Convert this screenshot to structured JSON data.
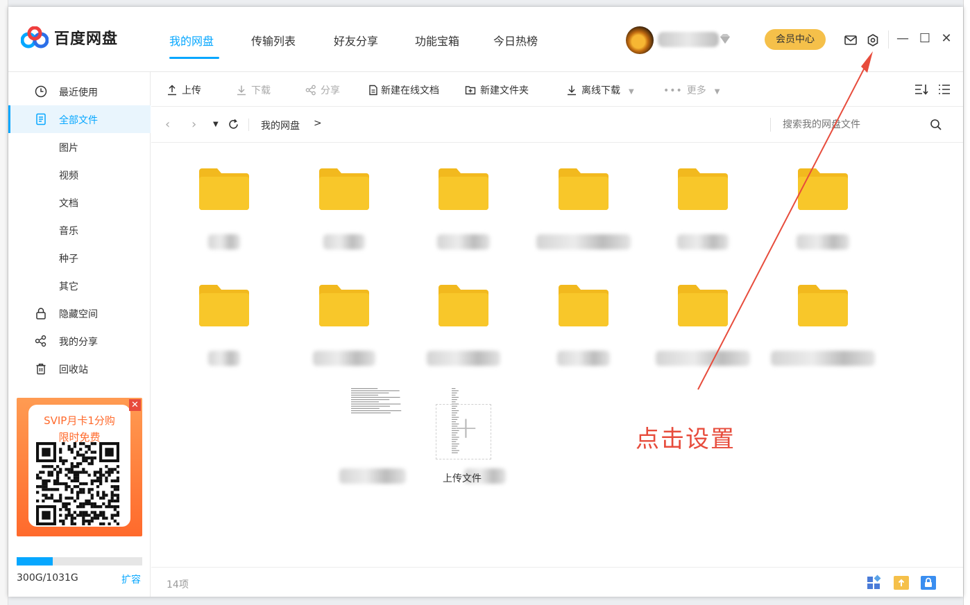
{
  "app": {
    "name": "百度网盘"
  },
  "nav": {
    "tabs": [
      {
        "label": "我的网盘",
        "active": true
      },
      {
        "label": "传输列表"
      },
      {
        "label": "好友分享"
      },
      {
        "label": "功能宝箱"
      },
      {
        "label": "今日热榜"
      }
    ]
  },
  "header": {
    "member_center": "会员中心",
    "icons": [
      "mail-icon",
      "settings-gear-icon"
    ],
    "window_controls": [
      "—",
      "☐",
      "✕"
    ]
  },
  "sidebar": {
    "items": [
      {
        "label": "最近使用",
        "icon": "clock-icon"
      },
      {
        "label": "全部文件",
        "icon": "file-icon",
        "active": true
      },
      {
        "label": "图片",
        "sub": true
      },
      {
        "label": "视频",
        "sub": true
      },
      {
        "label": "文档",
        "sub": true
      },
      {
        "label": "音乐",
        "sub": true
      },
      {
        "label": "种子",
        "sub": true
      },
      {
        "label": "其它",
        "sub": true
      },
      {
        "label": "隐藏空间",
        "icon": "lock-icon"
      },
      {
        "label": "我的分享",
        "icon": "share-icon"
      },
      {
        "label": "回收站",
        "icon": "trash-icon"
      }
    ],
    "promo": {
      "line1": "SVIP月卡1分购",
      "line2": "限时免费"
    },
    "storage": {
      "text": "300G/1031G",
      "used_fraction": 0.29,
      "expand": "扩容"
    }
  },
  "toolbar": {
    "upload": "上传",
    "download": "下载",
    "share": "分享",
    "new_doc": "新建在线文档",
    "new_folder": "新建文件夹",
    "offline": "离线下载",
    "more": "更多"
  },
  "pathbar": {
    "crumb": "我的网盘",
    "sep": ">",
    "search_placeholder": "搜索我的网盘文件"
  },
  "files": {
    "upload_label": "上传文件",
    "folder_color": "#f8c72a"
  },
  "status": {
    "count": "14项"
  },
  "annotation": {
    "text": "点击设置",
    "color": "#e74c3c"
  }
}
